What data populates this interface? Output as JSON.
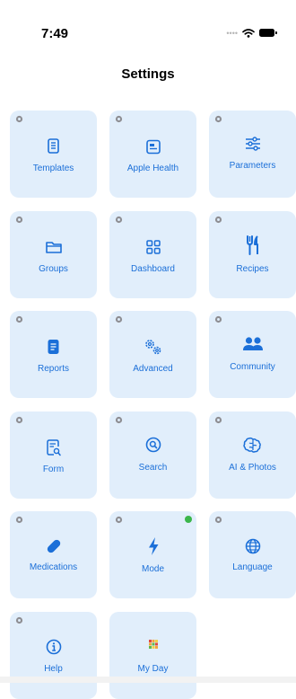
{
  "status_bar": {
    "time": "7:49",
    "signal_icon": "cellular-dots",
    "wifi_icon": "wifi",
    "battery_icon": "battery"
  },
  "header": {
    "title": "Settings"
  },
  "colors": {
    "tile_background": "#e1eefb",
    "accent": "#1b6fd8",
    "status_ok": "#3bb64b"
  },
  "tiles": [
    {
      "label": "Templates",
      "icon": "document-icon"
    },
    {
      "label": "Apple Health",
      "icon": "health-card-icon"
    },
    {
      "label": "Parameters",
      "icon": "sliders-icon"
    },
    {
      "label": "Groups",
      "icon": "folder-icon"
    },
    {
      "label": "Dashboard",
      "icon": "grid-icon"
    },
    {
      "label": "Recipes",
      "icon": "fork-knife-icon"
    },
    {
      "label": "Reports",
      "icon": "report-icon"
    },
    {
      "label": "Advanced",
      "icon": "gears-icon"
    },
    {
      "label": "Community",
      "icon": "people-icon"
    },
    {
      "label": "Form",
      "icon": "form-search-icon"
    },
    {
      "label": "Search",
      "icon": "search-circle-icon"
    },
    {
      "label": "AI & Photos",
      "icon": "brain-icon"
    },
    {
      "label": "Medications",
      "icon": "pill-icon"
    },
    {
      "label": "Mode",
      "icon": "bolt-icon",
      "active": true
    },
    {
      "label": "Language",
      "icon": "globe-icon"
    },
    {
      "label": "Help",
      "icon": "info-icon"
    },
    {
      "label": "My Day",
      "icon": "color-grid-icon"
    }
  ]
}
